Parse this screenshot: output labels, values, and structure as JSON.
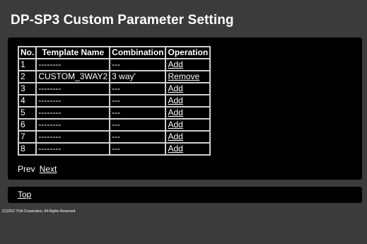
{
  "page": {
    "title": "DP-SP3 Custom Parameter Setting"
  },
  "table": {
    "headers": [
      "No.",
      "Template Name",
      "Combination",
      "Operation"
    ],
    "rows": [
      {
        "no": "1",
        "template": "--------",
        "combination": "---",
        "operation": "Add"
      },
      {
        "no": "2",
        "template": "CUSTOM_3WAY2",
        "combination": "3 way'",
        "operation": "Remove"
      },
      {
        "no": "3",
        "template": "--------",
        "combination": "---",
        "operation": "Add"
      },
      {
        "no": "4",
        "template": "--------",
        "combination": "---",
        "operation": "Add"
      },
      {
        "no": "5",
        "template": "--------",
        "combination": "---",
        "operation": "Add"
      },
      {
        "no": "6",
        "template": "--------",
        "combination": "---",
        "operation": "Add"
      },
      {
        "no": "7",
        "template": "--------",
        "combination": "---",
        "operation": "Add"
      },
      {
        "no": "8",
        "template": "--------",
        "combination": "---",
        "operation": "Add"
      }
    ]
  },
  "pager": {
    "prev_label": "Prev",
    "next_label": "Next"
  },
  "footer": {
    "top_label": "Top",
    "copyright": "(C)2012 TOA Corporation. All Rights Reserved."
  },
  "colors": {
    "background": "#3b3b3b",
    "panel": "#000000",
    "text": "#ffffff"
  }
}
